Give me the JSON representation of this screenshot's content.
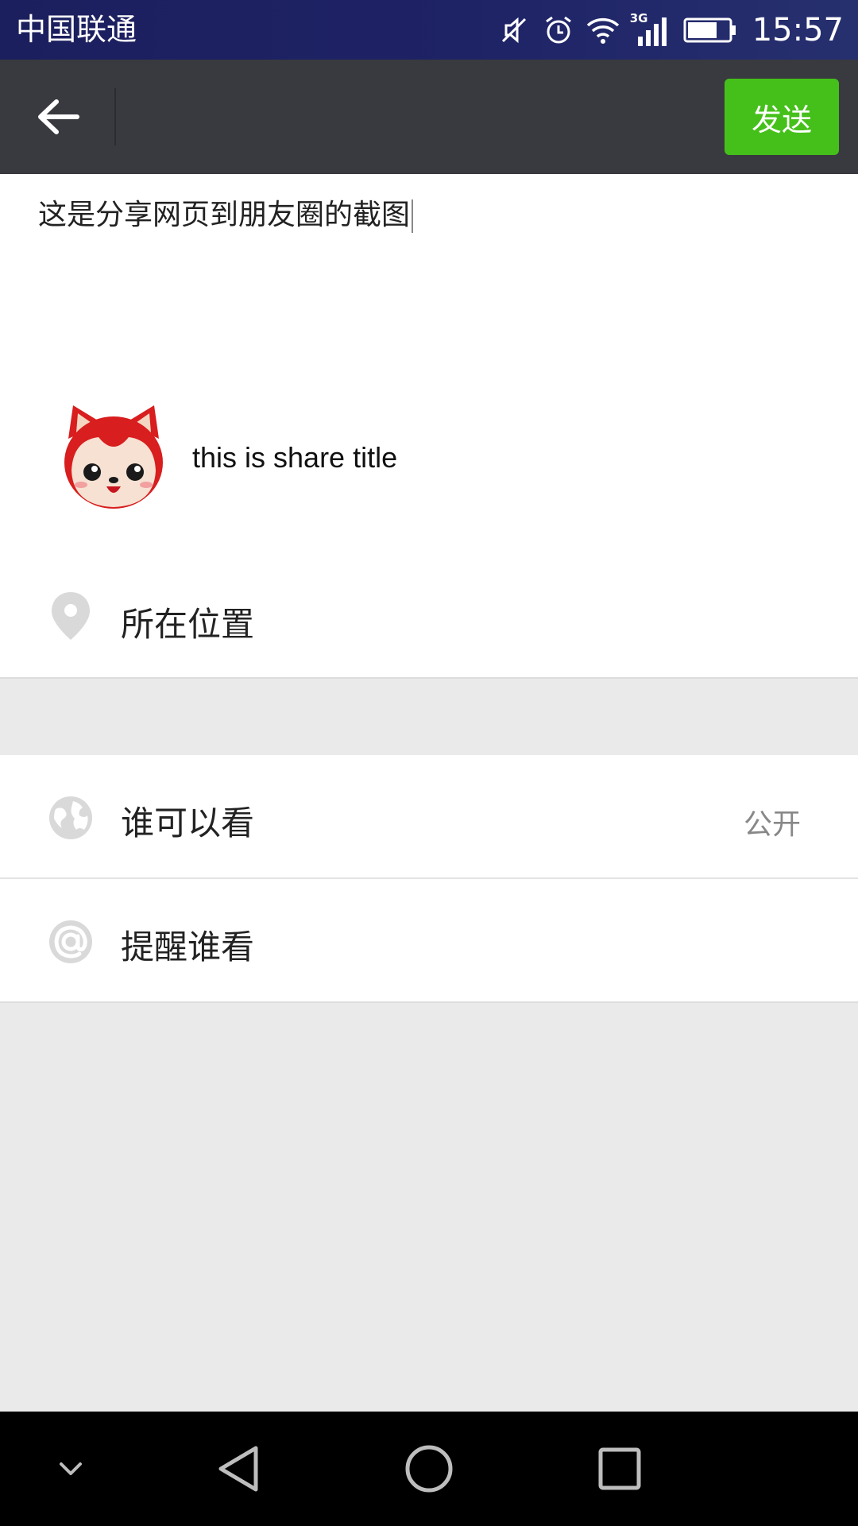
{
  "status_bar": {
    "carrier": "中国联通",
    "network_type": "3G",
    "time": "15:57",
    "icons": [
      "mute-icon",
      "alarm-icon",
      "wifi-icon",
      "signal-icon",
      "battery-icon"
    ]
  },
  "title_bar": {
    "back_icon": "back-arrow-icon",
    "send_label": "发送",
    "send_color": "#45c01a",
    "background": "#393a3f"
  },
  "post": {
    "text": "这是分享网页到朋友圈的截图"
  },
  "share_card": {
    "title": "this is share title",
    "thumbnail_icon": "fox-avatar-icon"
  },
  "location": {
    "icon": "location-pin-icon",
    "label": "所在位置"
  },
  "visibility": {
    "icon": "globe-icon",
    "label": "谁可以看",
    "value": "公开"
  },
  "remind": {
    "icon": "at-icon",
    "label": "提醒谁看"
  },
  "nav_bar": {
    "icons": [
      "collapse-icon",
      "nav-back-icon",
      "home-icon",
      "recents-icon"
    ]
  }
}
